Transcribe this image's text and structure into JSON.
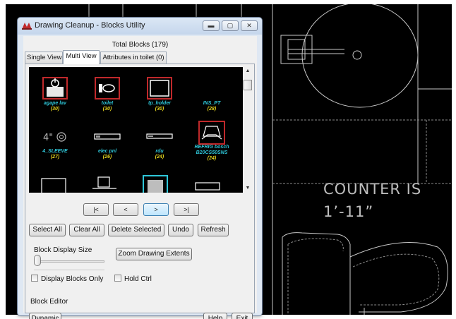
{
  "dialog": {
    "title": "Drawing Cleanup - Blocks Utility",
    "total_label": "Total Blocks (179)"
  },
  "tabs": [
    {
      "label": "Single View",
      "active": false
    },
    {
      "label": "Multi View",
      "active": true
    },
    {
      "label": "Attributes in toilet (0)",
      "active": false
    }
  ],
  "blocks": [
    {
      "name": "agape lav",
      "count": "(30)",
      "icon": "lavatory-block-icon",
      "selected": true
    },
    {
      "name": "toilet",
      "count": "(30)",
      "icon": "toilet-block-icon",
      "selected": true
    },
    {
      "name": "tp_holder",
      "count": "(30)",
      "icon": "tp-holder-block-icon",
      "selected": true
    },
    {
      "name": "INS_PT",
      "count": "(28)",
      "icon": "insertion-point-block-icon",
      "selected": false
    },
    {
      "name": "4_SLEEVE",
      "count": "(27)",
      "icon": "sleeve-block-icon",
      "selected": false,
      "thumb_text": "4\""
    },
    {
      "name": "elec pnl",
      "count": "(26)",
      "icon": "electrical-panel-block-icon",
      "selected": false
    },
    {
      "name": "rdu",
      "count": "(24)",
      "icon": "rdu-block-icon",
      "selected": false
    },
    {
      "name": "REFRIG bosch B20CS50SNS",
      "count": "(24)",
      "icon": "refrigerator-block-icon",
      "selected": true
    }
  ],
  "nav": {
    "first": "|<",
    "prev": "<",
    "next": ">",
    "last": ">|"
  },
  "actions": {
    "select_all": "Select All",
    "clear_all": "Clear All",
    "delete_selected": "Delete Selected",
    "undo": "Undo",
    "refresh": "Refresh"
  },
  "display_size": {
    "label": "Block Display Size",
    "level": 0
  },
  "zoom_button": "Zoom Drawing Extents",
  "checkboxes": {
    "display_blocks_only": {
      "label": "Display Blocks Only",
      "checked": false
    },
    "hold_ctrl": {
      "label": "Hold Ctrl",
      "checked": false
    }
  },
  "block_editor": {
    "label": "Block Editor",
    "dynamic": "Dynamic"
  },
  "footer": {
    "help": "Help",
    "exit": "Exit"
  },
  "cad": {
    "text_line1": "COUNTER IS",
    "text_line2": "1’-11”"
  },
  "colors": {
    "block_name": "#2ec6d8",
    "block_count": "#e2d21e",
    "selection_border": "#c0292b",
    "cad_background": "#000000"
  }
}
